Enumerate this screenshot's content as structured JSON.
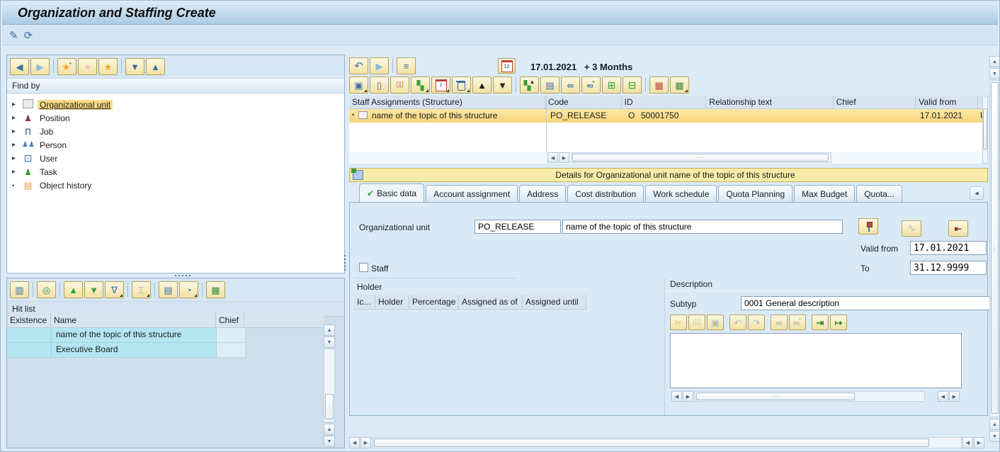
{
  "title": "Organization and Staffing Create",
  "icons": {
    "edit": "✎",
    "refresh": "⟳",
    "back": "◀",
    "forward": "▶",
    "star": "★",
    "plus": "+",
    "chevrons_down": "▼",
    "chevrons_up": "▲",
    "undo": "↶",
    "redo": "↷",
    "list": "≡",
    "cal12": "12",
    "cal7": "7",
    "copy_struct": "▣",
    "new": "▯",
    "copy": "▯▯",
    "org": "▚",
    "tri_up": "▲",
    "tri_down": "▼",
    "print": "▤",
    "binoculars": "∞",
    "zoom_in": "⊞",
    "zoom_out": "⊟",
    "blocks": "▦",
    "excel": "▦",
    "layout": "▥",
    "search": "◎",
    "sort_asc": "▲",
    "sort_desc": "▼",
    "filter": "∇",
    "sum": "Σ",
    "chart_pie": "◔",
    "cut": "✂",
    "paste": "▣",
    "import": "⇥",
    "export": "↦",
    "line_chart": "∿",
    "check": "✔",
    "dropdown": "▼",
    "nav_first": "⇤",
    "nav_prev": "◀",
    "nav_next": "▶",
    "nav_last": "⇥",
    "expander": "▸",
    "bullet": "•",
    "pawn": "♟",
    "pawn2": "♟♟",
    "bench": "Π",
    "monitor": "⊡",
    "scroll": "▤",
    "arr_up": "▲",
    "arr_down": "▼",
    "arr_left": "◀",
    "arr_right": "▶",
    "grip_v": "⋮",
    "grip_h": "⋯"
  },
  "left": {
    "find_by_header": "Find by",
    "tree": {
      "items": [
        {
          "label": "Organizational unit"
        },
        {
          "label": "Position"
        },
        {
          "label": "Job"
        },
        {
          "label": "Person"
        },
        {
          "label": "User"
        },
        {
          "label": "Task"
        },
        {
          "label": "Object history"
        }
      ]
    },
    "hit_list": {
      "header": "Hit list",
      "columns": {
        "existence": "Existence",
        "name": "Name",
        "chief": "Chief"
      },
      "rows": [
        {
          "existence": "",
          "name": "name of the topic of this structure",
          "chief": ""
        },
        {
          "existence": "",
          "name": "Executive Board",
          "chief": ""
        }
      ]
    }
  },
  "right": {
    "date": "17.01.2021",
    "period": "+ 3 Months",
    "staff": {
      "columns": {
        "structure": "Staff Assignments (Structure)",
        "code": "Code",
        "id": "ID",
        "relationship": "Relationship text",
        "chief": "Chief",
        "valid_from": "Valid from"
      },
      "rows": [
        {
          "name": "name of the topic of this structure",
          "code": "PO_RELEASE",
          "id_type": "O",
          "id": "50001750",
          "relationship": "",
          "chief": "",
          "valid_from": "17.01.2021",
          "valid_to": "U"
        }
      ]
    },
    "details": {
      "header": "Details for Organizational unit name of the topic of this structure",
      "tabs": [
        {
          "label": "Basic data"
        },
        {
          "label": "Account assignment"
        },
        {
          "label": "Address"
        },
        {
          "label": "Cost distribution"
        },
        {
          "label": "Work schedule"
        },
        {
          "label": "Quota Planning"
        },
        {
          "label": "Max Budget"
        },
        {
          "label": "Quota..."
        }
      ],
      "basic": {
        "org_unit_label": "Organizational unit",
        "code": "PO_RELEASE",
        "name": "name of the topic of this structure",
        "valid_from_label": "Valid from",
        "valid_from": "17.01.2021",
        "to_label": "To",
        "to": "31.12.9999",
        "staff_label": "Staff",
        "holder": {
          "header": "Holder",
          "columns": [
            "Ic...",
            "Holder",
            "Percentage",
            "Assigned as of",
            "Assigned until"
          ]
        },
        "description": {
          "header": "Description",
          "subtyp_label": "Subtyp",
          "subtyp_value": "0001 General description"
        }
      }
    }
  }
}
